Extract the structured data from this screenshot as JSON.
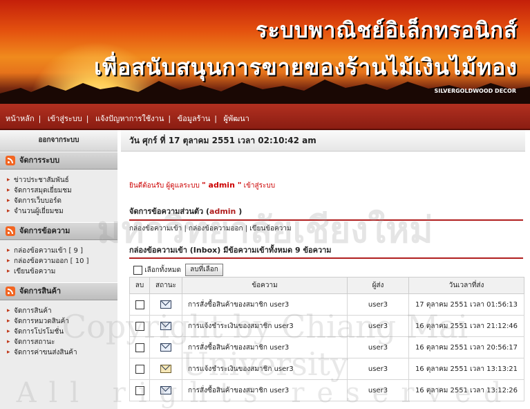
{
  "header": {
    "title_line1": "ระบบพาณิชย์อิเล็กทรอนิกส์",
    "title_line2": "เพื่อสนับสนุนการขายของร้านไม้เงินไม้ทอง",
    "brand": "SILVERGOLDWOOD DECOR"
  },
  "nav": {
    "items": [
      "หน้าหลัก",
      "เข้าสู่ระบบ",
      "แจ้งปัญหาการใช้งาน",
      "ข้อมูลร้าน",
      "ผู้พัฒนา"
    ]
  },
  "sidebar": {
    "logout": "ออกจากระบบ",
    "sections": [
      {
        "title": "จัดการระบบ",
        "items": [
          "ข่าวประชาสัมพันธ์",
          "จัดการสมุดเยี่ยมชม",
          "จัดการเว็บบอร์ด",
          "จำนวนผู้เยี่ยมชม"
        ]
      },
      {
        "title": "จัดการข้อความ",
        "items": [
          "กล่องข้อความเข้า [ 9 ]",
          "กล่องข้อความออก [ 10 ]",
          "เขียนข้อความ"
        ]
      },
      {
        "title": "จัดการสินค้า",
        "items": [
          "จัดการสินค้า",
          "จัดการหมวดสินค้า",
          "จัดการโปรโมชั่น",
          "จัดการสถานะ",
          "จัดการค่าขนส่งสินค้า"
        ]
      }
    ]
  },
  "main": {
    "date": "วัน ศุกร์ ที่ 17 ตุลาคม 2551 เวลา 02:10:42 am",
    "welcome_prefix": "ยินดีต้อนรับ ผู้ดูแลระบบ",
    "welcome_user": "\" admin \"",
    "welcome_suffix": "เข้าสู่ระบบ",
    "personal_title": "จัดการข้อความส่วนตัว (",
    "personal_user": "admin",
    "personal_close": ")",
    "sublinks": [
      "กล่องข้อความเข้า",
      "กล่องข้อความออก",
      "เขียนข้อความ"
    ],
    "inbox_title": "กล่องข้อความเข้า (Inbox) มีข้อความเข้าทั้งหมด  9  ข้อความ",
    "select_all": "เลือกทั้งหมด",
    "delete_button": "ลบที่เลือก",
    "columns": [
      "ลบ",
      "สถานะ",
      "ข้อความ",
      "ผู้ส่ง",
      "วันเวลาที่ส่ง"
    ],
    "rows": [
      {
        "subject": "การสั่งซื้อสินค้าของสมาชิก user3",
        "sender": "user3",
        "time": "17 ตุลาคม 2551 เวลา 01:56:13",
        "status_icon": "envelope-icon"
      },
      {
        "subject": "การแจ้งชำระเงินของสมาชิก user3",
        "sender": "user3",
        "time": "16 ตุลาคม 2551 เวลา 21:12:46",
        "status_icon": "envelope-icon"
      },
      {
        "subject": "การสั่งซื้อสินค้าของสมาชิก user3",
        "sender": "user3",
        "time": "16 ตุลาคม 2551 เวลา 20:56:17",
        "status_icon": "envelope-icon"
      },
      {
        "subject": "การแจ้งชำระเงินของสมาชิก user3",
        "sender": "user3",
        "time": "16 ตุลาคม 2551 เวลา 13:13:21",
        "status_icon": "open-envelope-icon"
      },
      {
        "subject": "การสั่งซื้อสินค้าของสมาชิก user3",
        "sender": "user3",
        "time": "16 ตุลาคม 2551 เวลา 13:12:26",
        "status_icon": "envelope-icon"
      }
    ]
  },
  "watermark": {
    "line1": "มหาวิทยาลัยเชียงใหม่",
    "line2": "Copyright by Chiang Mai University",
    "line3": "All rights reserved"
  }
}
